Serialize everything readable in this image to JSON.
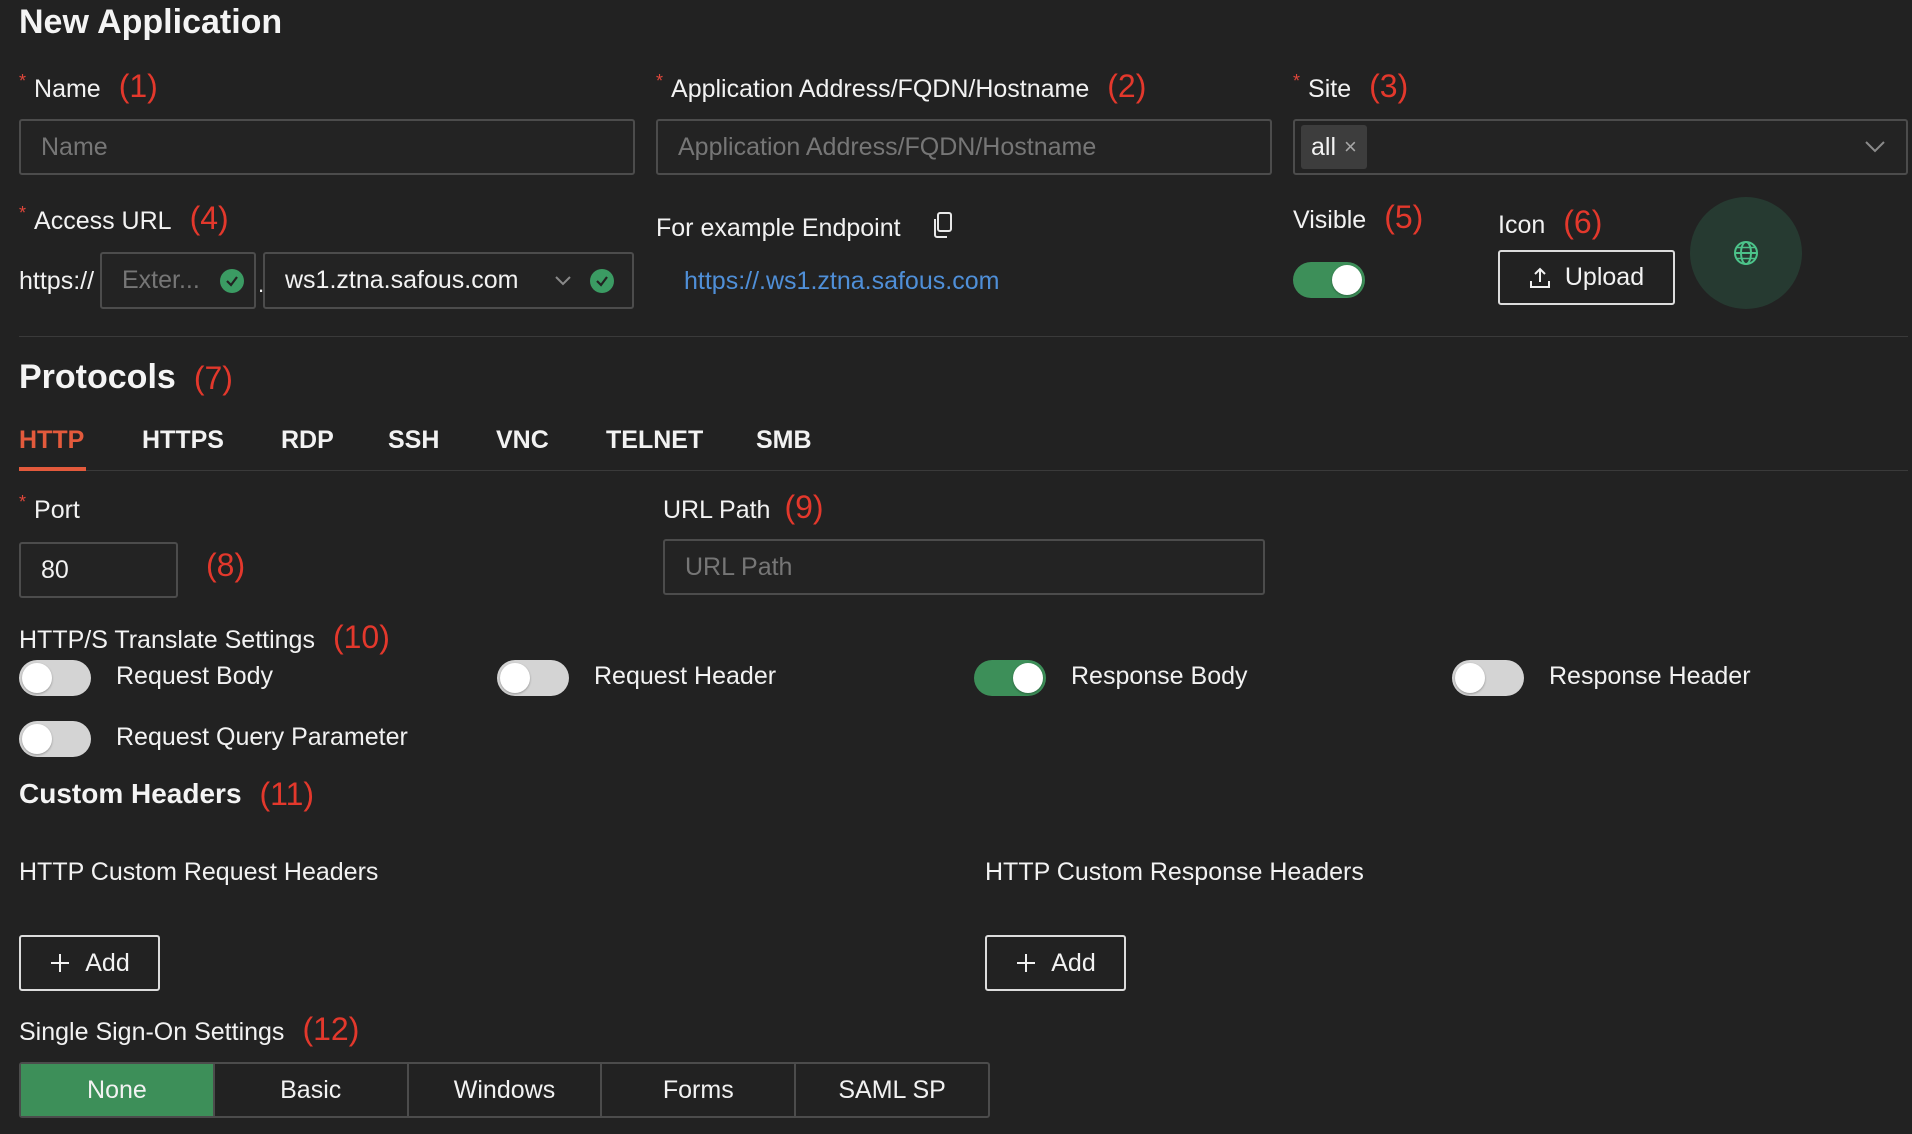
{
  "page": {
    "title": "New Application"
  },
  "required_mark": "*",
  "name": {
    "label": "Name",
    "annotation": "(1)",
    "placeholder": "Name"
  },
  "address": {
    "label": "Application Address/FQDN/Hostname",
    "annotation": "(2)",
    "placeholder": "Application Address/FQDN/Hostname"
  },
  "site": {
    "label": "Site",
    "annotation": "(3)",
    "tag": "all",
    "tag_remove": "×"
  },
  "access_url": {
    "label": "Access URL",
    "annotation": "(4)",
    "prefix": "https://",
    "subdomain_placeholder": "Exter...",
    "dot": ".",
    "domain": "ws1.ztna.safous.com"
  },
  "endpoint": {
    "label": "For example Endpoint",
    "url": "https://.ws1.ztna.safous.com"
  },
  "visible": {
    "label": "Visible",
    "annotation": "(5)",
    "on": true
  },
  "icon": {
    "label": "Icon",
    "annotation": "(6)",
    "upload_label": "Upload"
  },
  "protocols": {
    "title": "Protocols",
    "annotation": "(7)",
    "tabs": [
      "HTTP",
      "HTTPS",
      "RDP",
      "SSH",
      "VNC",
      "TELNET",
      "SMB"
    ],
    "active_tab": "HTTP"
  },
  "port": {
    "label": "Port",
    "annotation": "(8)",
    "value": "80"
  },
  "url_path": {
    "label": "URL Path",
    "annotation": "(9)",
    "placeholder": "URL Path"
  },
  "translate": {
    "title": "HTTP/S Translate Settings",
    "annotation": "(10)",
    "options": [
      {
        "label": "Request Body",
        "on": false
      },
      {
        "label": "Request Header",
        "on": false
      },
      {
        "label": "Response Body",
        "on": true
      },
      {
        "label": "Response Header",
        "on": false
      },
      {
        "label": "Request Query Parameter",
        "on": false
      }
    ]
  },
  "custom_headers": {
    "title": "Custom Headers",
    "annotation": "(11)",
    "request_label": "HTTP Custom Request Headers",
    "response_label": "HTTP Custom Response Headers",
    "add_label": "Add"
  },
  "sso": {
    "title": "Single Sign-On Settings",
    "annotation": "(12)",
    "options": [
      "None",
      "Basic",
      "Windows",
      "Forms",
      "SAML SP"
    ],
    "active": "None"
  },
  "colors": {
    "accent_green": "#3d8f59",
    "tab_active": "#e35a3c",
    "annotation_red": "#e3382c",
    "link_blue": "#4f8fd8"
  }
}
